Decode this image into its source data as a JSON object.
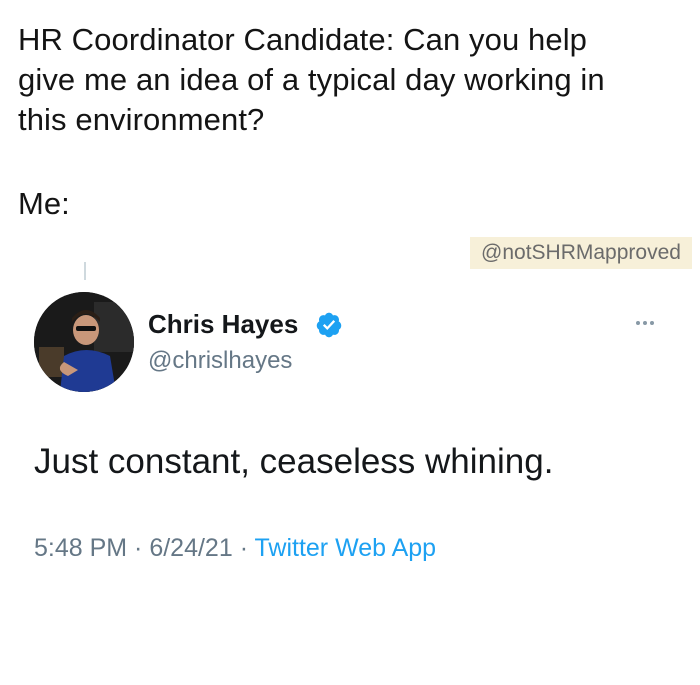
{
  "caption": {
    "lines": [
      "HR Coordinator Candidate: Can you help",
      "give me an idea of a typical day working in",
      "this environment?"
    ],
    "me_label": "Me:"
  },
  "watermark": "@notSHRMapproved",
  "tweet": {
    "author_name": "Chris Hayes",
    "handle": "@chrislhayes",
    "text": "Just constant, ceaseless whining.",
    "time": "5:48 PM",
    "date": "6/24/21",
    "source": "Twitter Web App",
    "separator": " · "
  },
  "icons": [
    "verified-badge-icon",
    "more-options-icon",
    "avatar-photo"
  ],
  "colors": {
    "verified": "#1da1f2",
    "link": "#1da1f2",
    "muted": "#657786",
    "watermark_bg": "#f7f0d9"
  }
}
